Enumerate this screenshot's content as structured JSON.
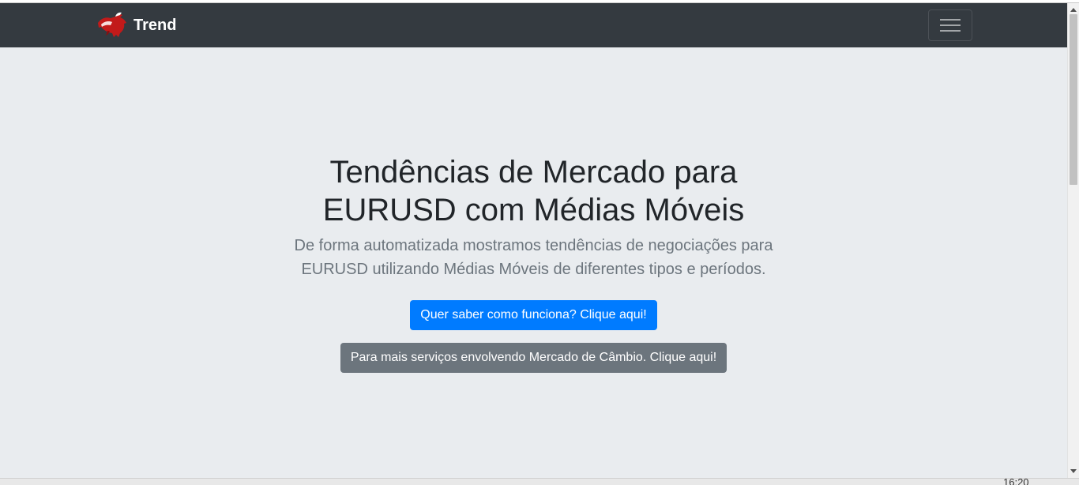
{
  "navbar": {
    "brand_text": "Trend",
    "brand_logo": "bull-logo-icon",
    "toggler_icon": "hamburger-menu-icon"
  },
  "hero": {
    "title": "Tendências de Mercado para EURUSD com Médias Móveis",
    "lead": "De forma automatizada mostramos tendências de negociações para EURUSD utilizando Médias Móveis de diferentes tipos e períodos.",
    "primary_button": "Quer saber como funciona? Clique aqui!",
    "secondary_button": "Para mais serviços envolvendo Mercado de Câmbio. Clique aqui!"
  },
  "taskbar": {
    "clock": "16:20"
  },
  "colors": {
    "navbar_bg": "#343a40",
    "page_bg": "#e9ecef",
    "primary": "#007bff",
    "secondary": "#6c757d",
    "heading_text": "#212529",
    "lead_text": "#6c757d"
  }
}
